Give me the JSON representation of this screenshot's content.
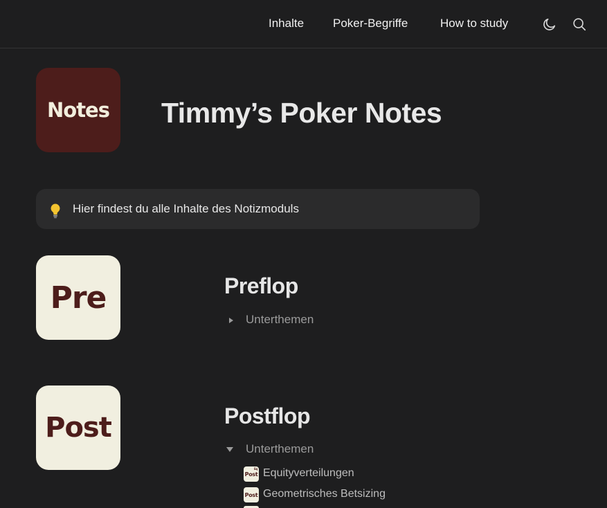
{
  "nav": {
    "links": [
      "Inhalte",
      "Poker-Begriffe",
      "How to study"
    ],
    "theme_toggle_icon": "moon-icon",
    "search_icon": "search-icon"
  },
  "header": {
    "logo_text": "Notes",
    "title": "Timmy’s Poker Notes"
  },
  "callout": {
    "icon": "lightbulb-icon",
    "text": "Hier findest du alle Inhalte des Notizmoduls"
  },
  "sections": [
    {
      "tile_text": "Pre",
      "title": "Preflop",
      "toggle_label": "Unterthemen",
      "expanded": false
    },
    {
      "tile_text": "Post",
      "title": "Postflop",
      "toggle_label": "Unterthemen",
      "expanded": true,
      "items": [
        {
          "icon_text": "Post",
          "icon_tag": "Eq",
          "label": "Equityverteilungen"
        },
        {
          "icon_text": "Post",
          "icon_tag": "",
          "label": "Geometrisches Betsizing"
        }
      ]
    }
  ],
  "colors": {
    "background": "#1e1e1f",
    "brand_dark": "#4d1d1b",
    "brand_light": "#f1efe0",
    "callout_bg": "#2b2b2c"
  }
}
